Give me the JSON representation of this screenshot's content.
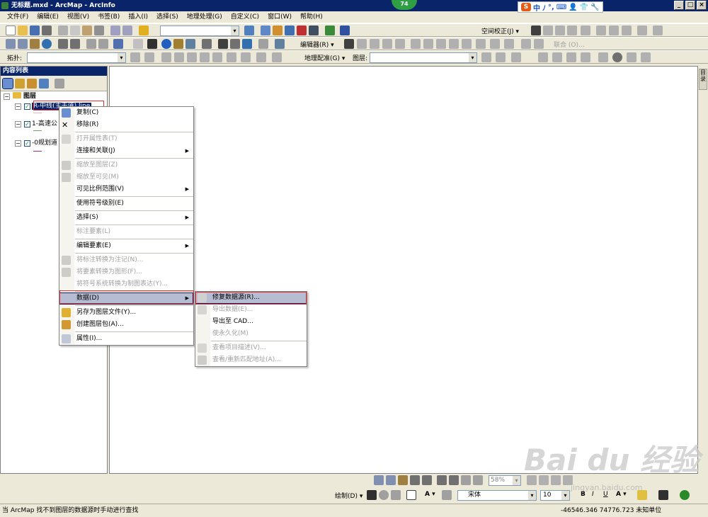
{
  "window": {
    "title": "无标题.mxd - ArcMap - ArcInfo",
    "badge": "74",
    "buttons": [
      "_",
      "□",
      "×"
    ]
  },
  "ime": {
    "logo": "S",
    "items": [
      "中",
      "ﾉ",
      "°,",
      "⌨",
      "👤",
      "👕",
      "🔧"
    ]
  },
  "menubar": [
    "文件(F)",
    "编辑(E)",
    "视图(V)",
    "书签(B)",
    "插入(I)",
    "选择(S)",
    "地理处理(G)",
    "自定义(C)",
    "窗口(W)",
    "帮助(H)"
  ],
  "toolbar": {
    "spatial_adjust": "空间校正(J) ▾",
    "editor": "编辑器(R) ▾",
    "georef": "地理配准(G) ▾",
    "layer_label": "图层:",
    "topology_label": "拓扑:",
    "join_label": "联合 (O)..."
  },
  "toc": {
    "title": "内容列表",
    "pin": "ᵖ",
    "close": "×",
    "root": "图层",
    "layers": [
      {
        "name": "R-中线(主干道).line",
        "selected": true
      },
      {
        "name": "1-高速公"
      },
      {
        "name": "-0规划道"
      }
    ]
  },
  "context_menu": {
    "items": [
      {
        "label": "复制(C)",
        "icon": "copy-icon",
        "disabled": false
      },
      {
        "label": "移除(R)",
        "icon": "remove-icon",
        "disabled": false
      },
      {
        "sep": true
      },
      {
        "label": "打开属性表(T)",
        "icon": "table-icon",
        "disabled": true
      },
      {
        "label": "连接和关联(J)",
        "arrow": true,
        "disabled": false
      },
      {
        "sep": true
      },
      {
        "label": "缩放至图层(Z)",
        "icon": "zoom-layer-icon",
        "disabled": true
      },
      {
        "label": "缩放至可见(M)",
        "icon": "zoom-visible-icon",
        "disabled": true
      },
      {
        "label": "可见比例范围(V)",
        "arrow": true,
        "disabled": false
      },
      {
        "sep": true
      },
      {
        "label": "使用符号级别(E)",
        "disabled": false
      },
      {
        "sep": true
      },
      {
        "label": "选择(S)",
        "arrow": true,
        "disabled": false
      },
      {
        "sep": true
      },
      {
        "label": "标注要素(L)",
        "disabled": true
      },
      {
        "sep": true
      },
      {
        "label": "编辑要素(E)",
        "arrow": true,
        "disabled": false
      },
      {
        "sep": true
      },
      {
        "label": "将标注转换为注记(N)...",
        "icon": "convert-icon",
        "disabled": true
      },
      {
        "label": "将要素转换为图形(F)...",
        "icon": "convert2-icon",
        "disabled": true
      },
      {
        "label": "将符号系统转换为制图表达(Y)...",
        "disabled": true
      },
      {
        "sep": true
      },
      {
        "label": "数据(D)",
        "arrow": true,
        "selected": true,
        "disabled": false
      },
      {
        "sep": true
      },
      {
        "label": "另存为图层文件(Y)...",
        "icon": "layer-file-icon",
        "disabled": false
      },
      {
        "label": "创建图层包(A)...",
        "icon": "package-icon",
        "disabled": false
      },
      {
        "sep": true
      },
      {
        "label": "属性(I)...",
        "icon": "properties-icon",
        "disabled": false
      }
    ]
  },
  "submenu": {
    "items": [
      {
        "label": "修复数据源(R)...",
        "icon": "repair-icon",
        "selected": true,
        "disabled": false
      },
      {
        "label": "导出数据(E)...",
        "icon": "export-icon",
        "disabled": true
      },
      {
        "label": "导出至 CAD...",
        "disabled": false
      },
      {
        "label": "使永久化(M)",
        "disabled": true
      },
      {
        "sep": true
      },
      {
        "label": "查看项目描述(V)...",
        "icon": "describe-icon",
        "disabled": true
      },
      {
        "label": "查看/重新匹配地址(A)...",
        "icon": "geocode-icon",
        "disabled": true
      }
    ]
  },
  "draw_toolbar": {
    "label": "绘制(D) ▾",
    "font": "宋体",
    "size": "10",
    "zoom": "58%",
    "bold": "B",
    "italic": "I",
    "underline": "U"
  },
  "status": {
    "message": "当 ArcMap 找不到图层的数据源时手动进行查找",
    "coords": "-46546.346  74776.723 未知单位"
  },
  "watermark": {
    "text": "Bai du 经验",
    "url": "jingyan.baidu.com"
  },
  "colors": {
    "title": "#0a246a",
    "highlight": "#e03030",
    "selected": "#b6bdd2"
  }
}
